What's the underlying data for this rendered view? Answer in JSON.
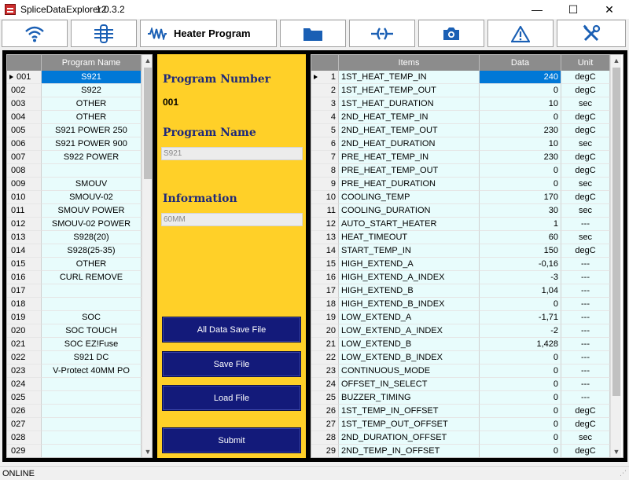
{
  "window": {
    "title": "SpliceDataExplorer2",
    "version": "1.0.3.2",
    "minimize_glyph": "—",
    "maximize_glyph": "☐",
    "close_glyph": "✕"
  },
  "toolbar": {
    "active_label": "Heater Program",
    "buttons": [
      "wifi-icon",
      "splice-icon",
      "heater-wave-icon",
      "folder-icon",
      "fiber-icon",
      "camera-icon",
      "warning-icon",
      "tools-icon"
    ],
    "accent_color": "#1a5fb4"
  },
  "program_list": {
    "col_num_header": "",
    "col_name_header": "Program Name",
    "selected_index": 0,
    "rows": [
      {
        "num": "001",
        "name": "S921"
      },
      {
        "num": "002",
        "name": "S922"
      },
      {
        "num": "003",
        "name": "OTHER"
      },
      {
        "num": "004",
        "name": "OTHER"
      },
      {
        "num": "005",
        "name": "S921 POWER 250"
      },
      {
        "num": "006",
        "name": "S921 POWER 900"
      },
      {
        "num": "007",
        "name": "S922 POWER"
      },
      {
        "num": "008",
        "name": ""
      },
      {
        "num": "009",
        "name": "SMOUV"
      },
      {
        "num": "010",
        "name": "SMOUV-02"
      },
      {
        "num": "011",
        "name": "SMOUV POWER"
      },
      {
        "num": "012",
        "name": "SMOUV-02 POWER"
      },
      {
        "num": "013",
        "name": "S928(20)"
      },
      {
        "num": "014",
        "name": "S928(25-35)"
      },
      {
        "num": "015",
        "name": "OTHER"
      },
      {
        "num": "016",
        "name": "CURL REMOVE"
      },
      {
        "num": "017",
        "name": ""
      },
      {
        "num": "018",
        "name": ""
      },
      {
        "num": "019",
        "name": "SOC"
      },
      {
        "num": "020",
        "name": "SOC TOUCH"
      },
      {
        "num": "021",
        "name": "SOC EZ!Fuse"
      },
      {
        "num": "022",
        "name": "S921 DC"
      },
      {
        "num": "023",
        "name": "V-Protect 40MM PO"
      },
      {
        "num": "024",
        "name": ""
      },
      {
        "num": "025",
        "name": ""
      },
      {
        "num": "026",
        "name": ""
      },
      {
        "num": "027",
        "name": ""
      },
      {
        "num": "028",
        "name": ""
      },
      {
        "num": "029",
        "name": ""
      }
    ]
  },
  "details": {
    "program_number_label": "Program Number",
    "program_number_value": "001",
    "program_name_label": "Program Name",
    "program_name_value": "S921",
    "information_label": "Information",
    "information_value": "60MM",
    "buttons": {
      "all_data_save": "All Data Save File",
      "save": "Save File",
      "load": "Load File",
      "submit": "Submit"
    },
    "panel_color": "#ffd028",
    "button_color": "#131a7a"
  },
  "items_table": {
    "col_num_header": "",
    "col_item_header": "Items",
    "col_data_header": "Data",
    "col_unit_header": "Unit",
    "selected_index": 0,
    "rows": [
      {
        "num": "1",
        "item": "1ST_HEAT_TEMP_IN",
        "data": "240",
        "unit": "degC"
      },
      {
        "num": "2",
        "item": "1ST_HEAT_TEMP_OUT",
        "data": "0",
        "unit": "degC"
      },
      {
        "num": "3",
        "item": "1ST_HEAT_DURATION",
        "data": "10",
        "unit": "sec"
      },
      {
        "num": "4",
        "item": "2ND_HEAT_TEMP_IN",
        "data": "0",
        "unit": "degC"
      },
      {
        "num": "5",
        "item": "2ND_HEAT_TEMP_OUT",
        "data": "230",
        "unit": "degC"
      },
      {
        "num": "6",
        "item": "2ND_HEAT_DURATION",
        "data": "10",
        "unit": "sec"
      },
      {
        "num": "7",
        "item": "PRE_HEAT_TEMP_IN",
        "data": "230",
        "unit": "degC"
      },
      {
        "num": "8",
        "item": "PRE_HEAT_TEMP_OUT",
        "data": "0",
        "unit": "degC"
      },
      {
        "num": "9",
        "item": "PRE_HEAT_DURATION",
        "data": "0",
        "unit": "sec"
      },
      {
        "num": "10",
        "item": "COOLING_TEMP",
        "data": "170",
        "unit": "degC"
      },
      {
        "num": "11",
        "item": "COOLING_DURATION",
        "data": "30",
        "unit": "sec"
      },
      {
        "num": "12",
        "item": "AUTO_START_HEATER",
        "data": "1",
        "unit": "---"
      },
      {
        "num": "13",
        "item": "HEAT_TIMEOUT",
        "data": "60",
        "unit": "sec"
      },
      {
        "num": "14",
        "item": "START_TEMP_IN",
        "data": "150",
        "unit": "degC"
      },
      {
        "num": "15",
        "item": "HIGH_EXTEND_A",
        "data": "-0,16",
        "unit": "---"
      },
      {
        "num": "16",
        "item": "HIGH_EXTEND_A_INDEX",
        "data": "-3",
        "unit": "---"
      },
      {
        "num": "17",
        "item": "HIGH_EXTEND_B",
        "data": "1,04",
        "unit": "---"
      },
      {
        "num": "18",
        "item": "HIGH_EXTEND_B_INDEX",
        "data": "0",
        "unit": "---"
      },
      {
        "num": "19",
        "item": "LOW_EXTEND_A",
        "data": "-1,71",
        "unit": "---"
      },
      {
        "num": "20",
        "item": "LOW_EXTEND_A_INDEX",
        "data": "-2",
        "unit": "---"
      },
      {
        "num": "21",
        "item": "LOW_EXTEND_B",
        "data": "1,428",
        "unit": "---"
      },
      {
        "num": "22",
        "item": "LOW_EXTEND_B_INDEX",
        "data": "0",
        "unit": "---"
      },
      {
        "num": "23",
        "item": "CONTINUOUS_MODE",
        "data": "0",
        "unit": "---"
      },
      {
        "num": "24",
        "item": "OFFSET_IN_SELECT",
        "data": "0",
        "unit": "---"
      },
      {
        "num": "25",
        "item": "BUZZER_TIMING",
        "data": "0",
        "unit": "---"
      },
      {
        "num": "26",
        "item": "1ST_TEMP_IN_OFFSET",
        "data": "0",
        "unit": "degC"
      },
      {
        "num": "27",
        "item": "1ST_TEMP_OUT_OFFSET",
        "data": "0",
        "unit": "degC"
      },
      {
        "num": "28",
        "item": "2ND_DURATION_OFFSET",
        "data": "0",
        "unit": "sec"
      },
      {
        "num": "29",
        "item": "2ND_TEMP_IN_OFFSET",
        "data": "0",
        "unit": "degC"
      }
    ]
  },
  "status": {
    "text": "ONLINE",
    "grip_glyph": "⋰"
  }
}
